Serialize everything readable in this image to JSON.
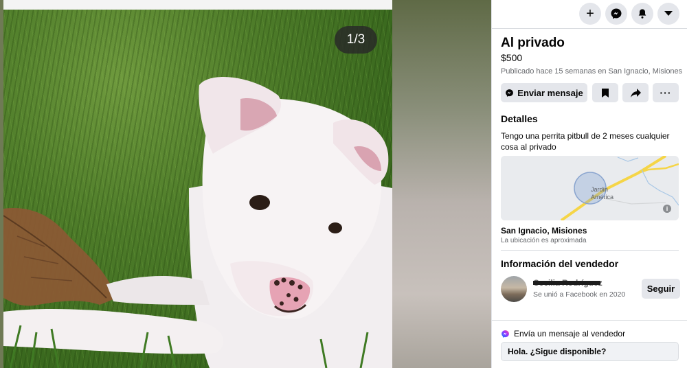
{
  "viewer": {
    "counter": "1/3",
    "photo_icon": "pitbull-puppy-photo"
  },
  "topbar": {
    "buttons": [
      {
        "icon": "plus-icon"
      },
      {
        "icon": "messenger-icon"
      },
      {
        "icon": "bell-icon"
      },
      {
        "icon": "caret-down-icon"
      }
    ]
  },
  "listing": {
    "title": "Al privado",
    "price": "$500",
    "posted": "Publicado hace 15 semanas en San Ignacio, Misiones",
    "send_message_label": "Enviar mensaje"
  },
  "details": {
    "heading": "Detalles",
    "description": "Tengo una perrita pitbull de 2 meses cualquier cosa al privado",
    "map_label_line1": "Jardín",
    "map_label_line2": "América",
    "location": "San Ignacio, Misiones",
    "location_note": "La ubicación es aproximada"
  },
  "seller": {
    "heading": "Información del vendedor",
    "name": "Cecilia Rodríguez",
    "joined": "Se unió a Facebook en 2020",
    "follow_label": "Seguir"
  },
  "message": {
    "heading": "Envía un mensaje al vendedor",
    "input_value": "Hola. ¿Sigue disponible?"
  },
  "colors": {
    "accent": "#1877f2",
    "button_bg": "#e4e6eb",
    "text_secondary": "#65676b",
    "map_road": "#f5d547"
  }
}
